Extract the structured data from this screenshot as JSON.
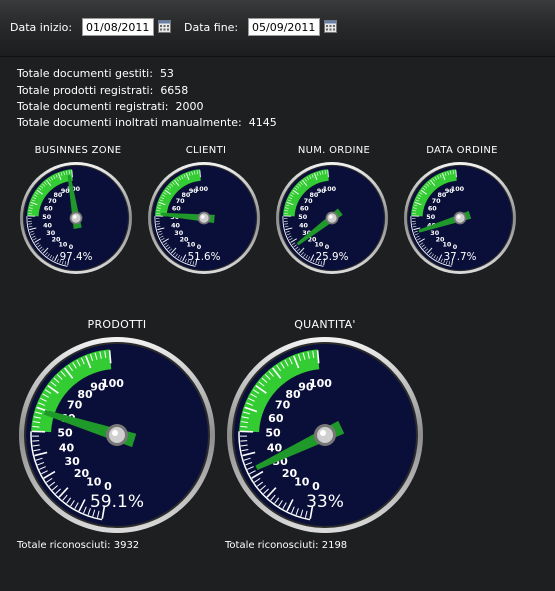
{
  "filters": {
    "start_label": "Data inizio:",
    "start_value": "01/08/2011",
    "end_label": "Data fine:",
    "end_value": "05/09/2011",
    "calendar_icon": "calendar-icon"
  },
  "stats": [
    {
      "label": "Totale documenti gestiti:",
      "value": "53"
    },
    {
      "label": "Totale prodotti registrati:",
      "value": "6658"
    },
    {
      "label": "Totale documenti registrati:",
      "value": "2000"
    },
    {
      "label": "Totale documenti inoltrati manualmente:",
      "value": "4145"
    }
  ],
  "gauges_small": [
    {
      "title": "BUSINNES ZONE",
      "value": 97.4,
      "display": "97.4%"
    },
    {
      "title": "CLIENTI",
      "value": 51.6,
      "display": "51.6%"
    },
    {
      "title": "NUM. ORDINE",
      "value": 25.9,
      "display": "25.9%"
    },
    {
      "title": "DATA ORDINE",
      "value": 37.7,
      "display": "37.7%"
    }
  ],
  "gauges_large": [
    {
      "title": "PRODOTTI",
      "value": 59.1,
      "display": "59.1%",
      "footer": "Totale riconosciuti: 3932"
    },
    {
      "title": "QUANTITA'",
      "value": 33,
      "display": "33%",
      "footer": "Totale riconosciuti: 2198"
    }
  ],
  "gauge_scale": {
    "min": 0,
    "max": 100,
    "green_from": 50,
    "ticks": [
      "0",
      "10",
      "20",
      "30",
      "40",
      "50",
      "60",
      "70",
      "80",
      "90",
      "100"
    ]
  },
  "colors": {
    "dial": "#0a0f3a",
    "green": "#33cc33",
    "needle": "#1f9a2a",
    "rim": "#c8c8c8"
  }
}
